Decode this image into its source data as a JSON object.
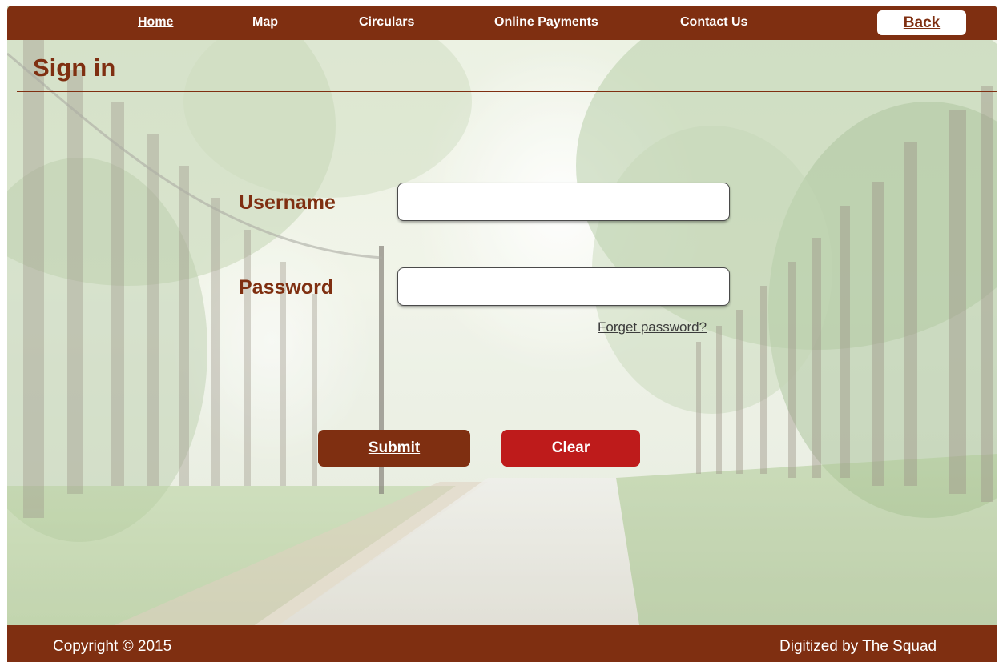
{
  "nav": {
    "items": [
      {
        "label": "Home",
        "active": true
      },
      {
        "label": "Map",
        "active": false
      },
      {
        "label": "Circulars",
        "active": false
      },
      {
        "label": "Online Payments",
        "active": false
      },
      {
        "label": "Contact Us",
        "active": false
      }
    ],
    "back_label": "Back"
  },
  "page": {
    "title": "Sign in"
  },
  "form": {
    "username_label": "Username",
    "username_value": "",
    "password_label": "Password",
    "password_value": "",
    "forgot_label": "Forget password?",
    "submit_label": "Submit",
    "clear_label": "Clear"
  },
  "footer": {
    "copyright": "Copyright © 2015",
    "credit": "Digitized by The Squad"
  },
  "colors": {
    "brand": "#7f2f11",
    "clear_button": "#be1b1b",
    "background": "#ffffff"
  }
}
